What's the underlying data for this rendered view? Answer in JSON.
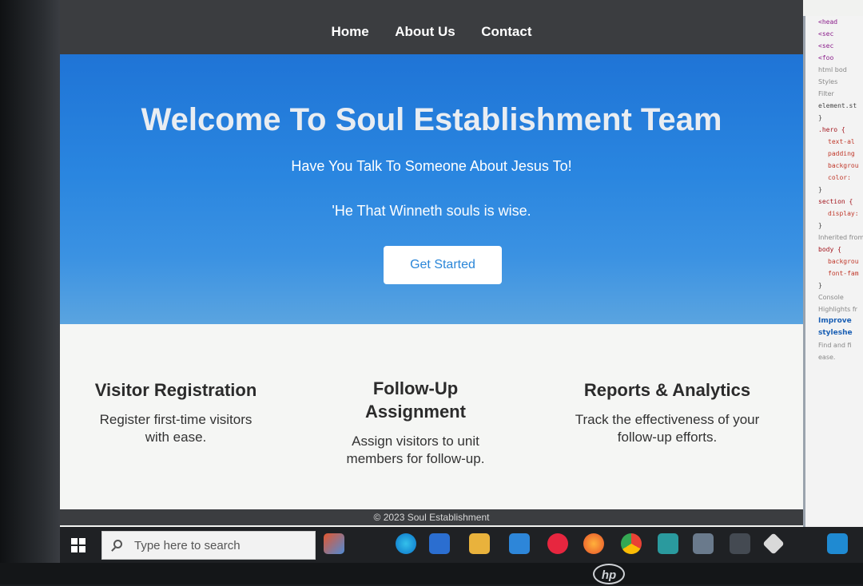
{
  "nav": {
    "items": [
      "Home",
      "About Us",
      "Contact"
    ]
  },
  "hero": {
    "title": "Welcome To Soul Establishment Team",
    "subtitle": "Have You Talk To Someone About Jesus To!",
    "quote": "'He That Winneth souls is wise.",
    "cta_label": "Get Started"
  },
  "features": [
    {
      "title": "Visitor Registration",
      "text": "Register first-time visitors with ease."
    },
    {
      "title": "Follow-Up Assignment",
      "text": "Assign visitors to unit members for follow-up."
    },
    {
      "title": "Reports & Analytics",
      "text": "Track the effectiveness of your follow-up efforts."
    }
  ],
  "footer": {
    "text": "© 2023 Soul Establishment"
  },
  "devtools": {
    "lines": [
      "<head",
      "<sec",
      "<sec",
      "<foo",
      "html  bod",
      "Styles",
      "Filter",
      "element.st",
      "}",
      ".hero {",
      "text-al",
      "padding",
      "backgrou",
      "color:",
      "}",
      "section {",
      "display:",
      "}",
      "Inherited from",
      "body {",
      "backgrou",
      "font-fam",
      "}",
      "Console",
      "Highlights fr",
      "Improve",
      "styleshe",
      "Find and fi",
      "ease."
    ]
  },
  "taskbar": {
    "search_placeholder": "Type here to search",
    "apps": [
      "widgets-icon",
      "edge-icon",
      "store-icon",
      "file-explorer-icon",
      "mail-icon",
      "opera-icon",
      "firefox-icon",
      "chrome-icon",
      "terminal-icon",
      "app-icon",
      "video-icon",
      "app-icon-2",
      "vscode-icon"
    ]
  },
  "brand": {
    "monitor": "hp"
  },
  "colors": {
    "hero_top": "#1f74d6",
    "hero_bottom": "#5aa4e0",
    "header": "#3b3d40",
    "button_text": "#2a86d8"
  }
}
